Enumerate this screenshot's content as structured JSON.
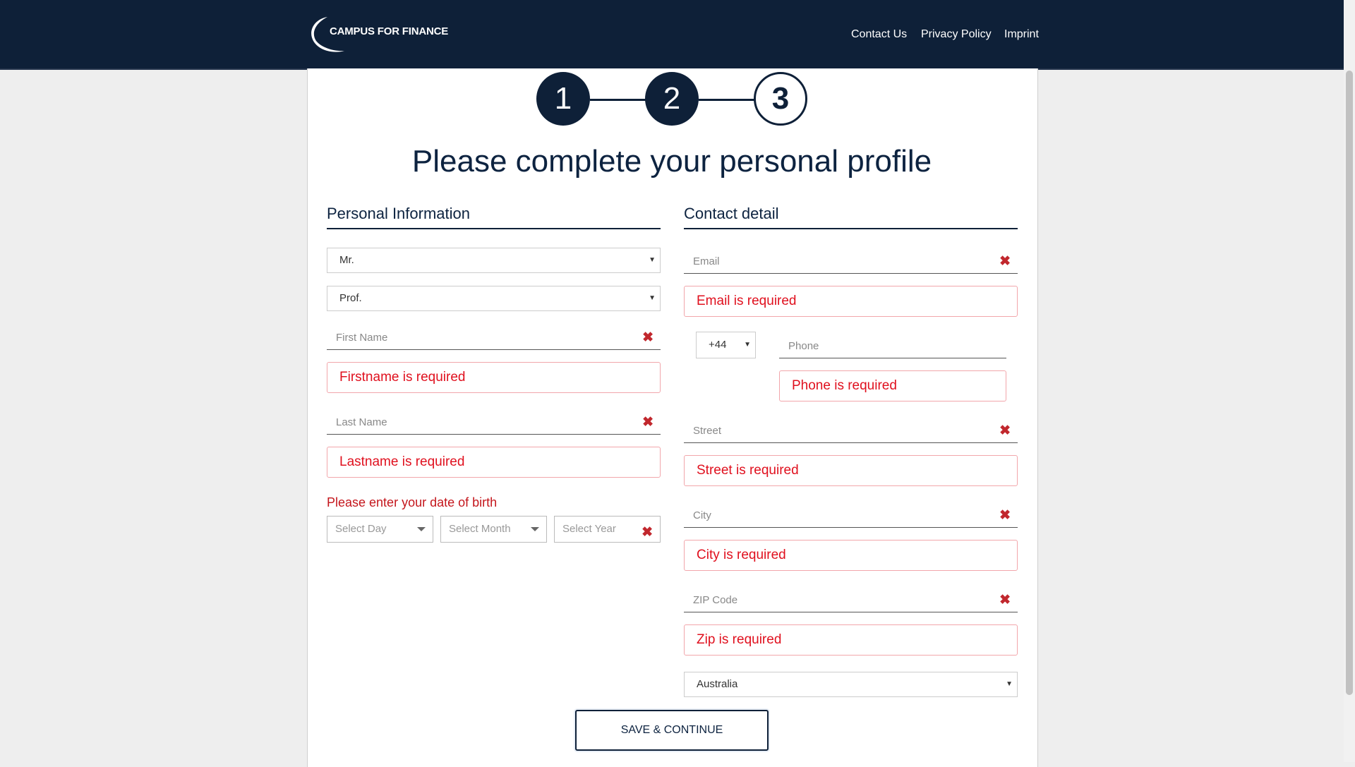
{
  "header": {
    "logo_text": "CAMPUS FOR FINANCE",
    "nav": [
      "Contact Us",
      "Privacy Policy",
      "Imprint"
    ]
  },
  "stepper": {
    "steps": [
      "1",
      "2",
      "3"
    ],
    "current": 3
  },
  "title": "Please complete your personal profile",
  "personal": {
    "heading": "Personal Information",
    "salutation": "Mr.",
    "academic_title": "Prof.",
    "first_name_placeholder": "First Name",
    "first_name_error": "Firstname is required",
    "last_name_placeholder": "Last Name",
    "last_name_error": "Lastname is required",
    "dob_label": "Please enter your date of birth",
    "day_placeholder": "Select Day",
    "month_placeholder": "Select Month",
    "year_placeholder": "Select Year"
  },
  "contact": {
    "heading": "Contact detail",
    "email_placeholder": "Email",
    "email_error": "Email is required",
    "phone_code": "+44",
    "phone_placeholder": "Phone",
    "phone_error": "Phone is required",
    "street_placeholder": "Street",
    "street_error": "Street is required",
    "city_placeholder": "City",
    "city_error": "City is required",
    "zip_placeholder": "ZIP Code",
    "zip_error": "Zip is required",
    "country": "Australia"
  },
  "icons": {
    "clear": "✖",
    "caret": "▼"
  },
  "save_label": "SAVE & CONTINUE",
  "colors": {
    "navy": "#0e2038",
    "error": "#e0101e"
  }
}
